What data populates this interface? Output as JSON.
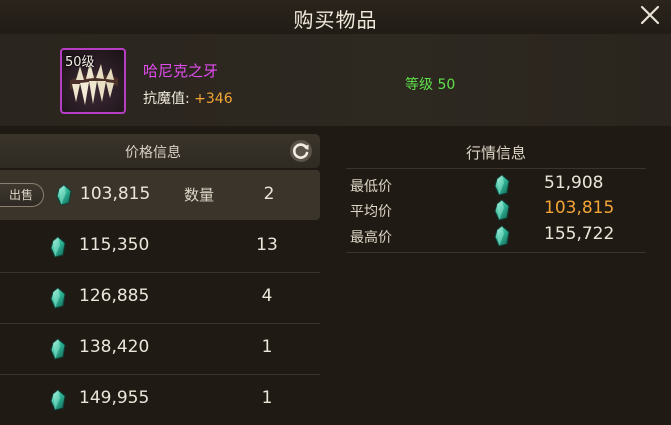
{
  "window": {
    "title": "购买物品"
  },
  "item": {
    "level_badge": "50级",
    "name": "哈尼克之牙",
    "stat_label": "抗魔值:",
    "stat_value": "+346",
    "level_text": "等级 50",
    "icon": "fang-icon",
    "name_color": "#e24cf0"
  },
  "price_panel": {
    "header": "价格信息",
    "sell_label": "出售",
    "qty_label": "数量",
    "rows": [
      {
        "price": "103,815",
        "qty": "2"
      },
      {
        "price": "115,350",
        "qty": "13"
      },
      {
        "price": "126,885",
        "qty": "4"
      },
      {
        "price": "138,420",
        "qty": "1"
      },
      {
        "price": "149,955",
        "qty": "1"
      }
    ]
  },
  "market_panel": {
    "header": "行情信息",
    "rows": [
      {
        "label": "最低价",
        "value": "51,908"
      },
      {
        "label": "平均价",
        "value": "103,815"
      },
      {
        "label": "最高价",
        "value": "155,722"
      }
    ]
  },
  "colors": {
    "accent_orange": "#f3a536",
    "level_green": "#5ee04a",
    "gem_teal": "#3fc7a8"
  }
}
